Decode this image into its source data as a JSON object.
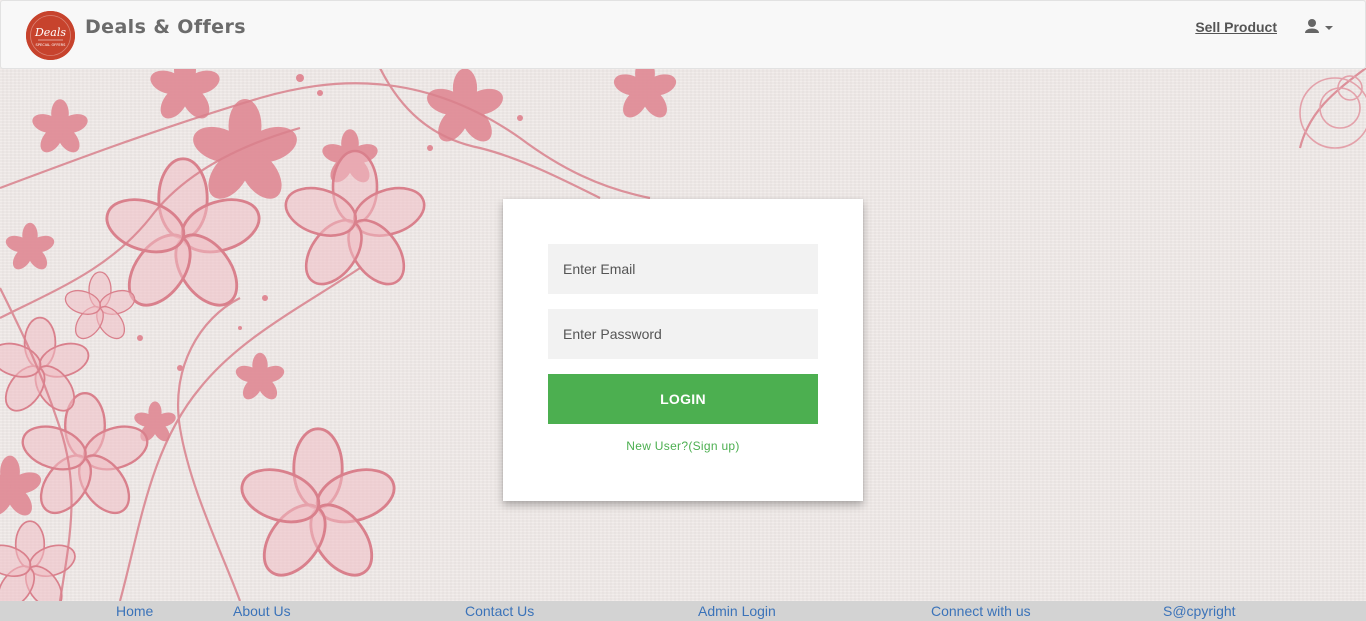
{
  "navbar": {
    "brand": "Deals & Offers",
    "logo_text": "Deals",
    "logo_subtext": "SPECIAL OFFERS",
    "sell_link": "Sell Product",
    "user_icon": "user-icon",
    "caret_icon": "caret-down-icon"
  },
  "login": {
    "email_placeholder": "Enter Email",
    "email_value": "",
    "password_placeholder": "Enter Password",
    "password_value": "",
    "button_label": "LOGIN",
    "signup_link": "New User?(Sign up)"
  },
  "footer": {
    "links": [
      "Home",
      "About Us",
      "Contact Us",
      "Admin Login",
      "Connect with us",
      "S@cpyright"
    ]
  },
  "colors": {
    "accent": "#4caf50",
    "logo": "#c7432d",
    "link": "#3b73b9",
    "floral": "#e08a95"
  }
}
